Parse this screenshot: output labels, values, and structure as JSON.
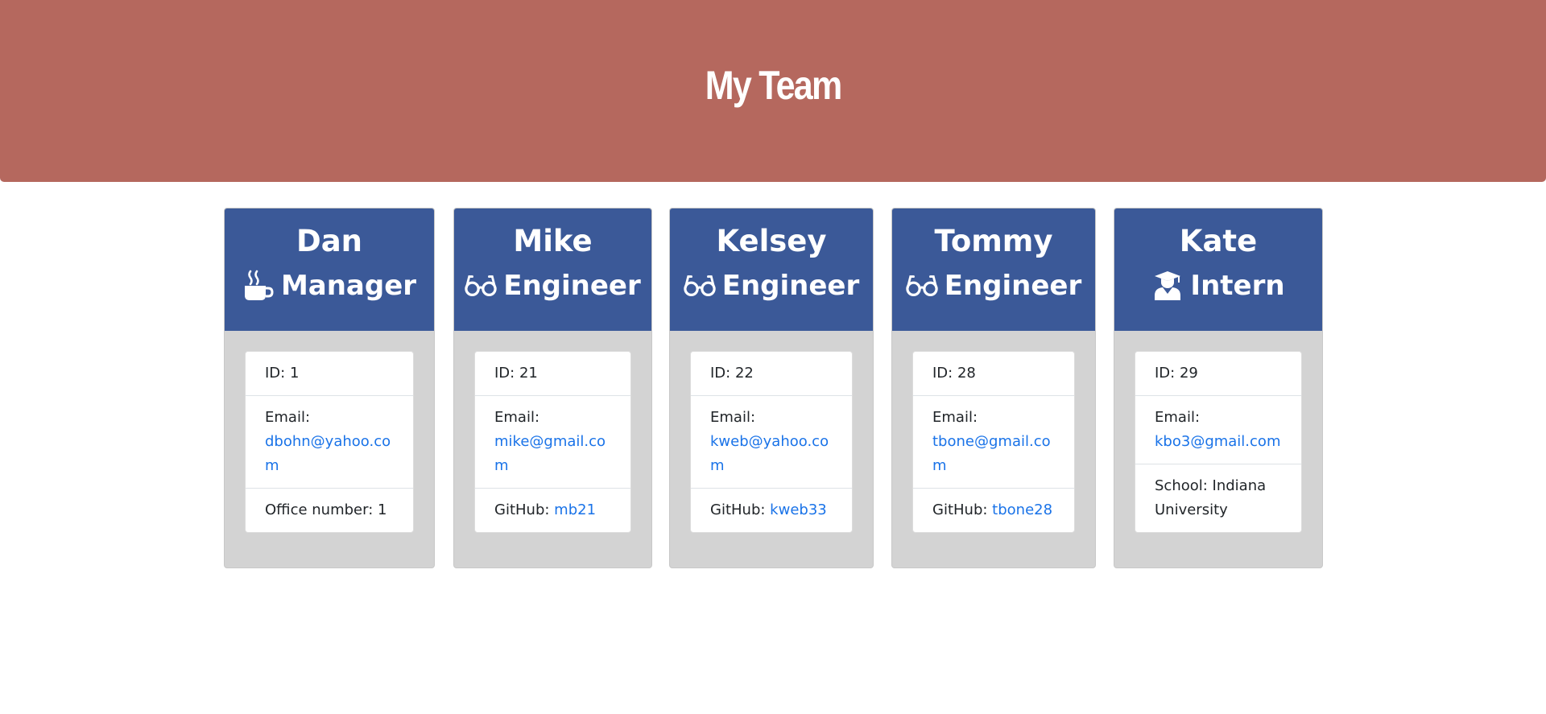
{
  "header": {
    "title": "My Team"
  },
  "team": [
    {
      "name": "Dan",
      "role": "Manager",
      "role_icon": "mug-hot-icon",
      "id_label": "ID: 1",
      "email_label": "Email:",
      "email": "dbohn@yahoo.com",
      "extra_label": "Office number: 1",
      "extra_link": ""
    },
    {
      "name": "Mike",
      "role": "Engineer",
      "role_icon": "glasses-icon",
      "id_label": "ID: 21",
      "email_label": "Email:",
      "email": "mike@gmail.com",
      "extra_label": "GitHub: ",
      "extra_link": "mb21"
    },
    {
      "name": "Kelsey",
      "role": "Engineer",
      "role_icon": "glasses-icon",
      "id_label": "ID: 22",
      "email_label": "Email:",
      "email": "kweb@yahoo.com",
      "extra_label": "GitHub: ",
      "extra_link": "kweb33"
    },
    {
      "name": "Tommy",
      "role": "Engineer",
      "role_icon": "glasses-icon",
      "id_label": "ID: 28",
      "email_label": "Email:",
      "email": "tbone@gmail.com",
      "extra_label": "GitHub: ",
      "extra_link": "tbone28"
    },
    {
      "name": "Kate",
      "role": "Intern",
      "role_icon": "user-graduate-icon",
      "id_label": "ID: 29",
      "email_label": "Email:",
      "email": "kbo3@gmail.com",
      "extra_label": "School: Indiana University",
      "extra_link": ""
    }
  ],
  "colors": {
    "jumbotron": "#b5685e",
    "card_header": "#3b5998",
    "card_body": "#d3d3d3",
    "link": "#1a73e8"
  }
}
